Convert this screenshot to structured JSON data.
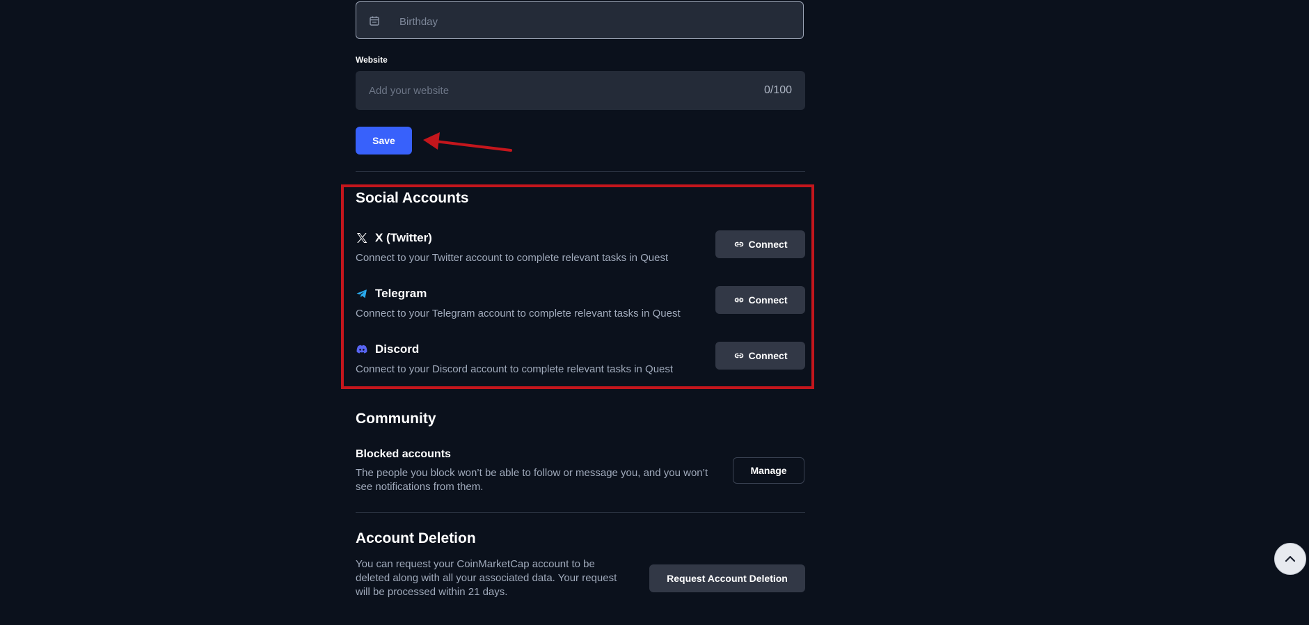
{
  "profile": {
    "birthday_placeholder": "Birthday",
    "website_label": "Website",
    "website_placeholder": "Add your website",
    "website_value": "",
    "website_counter": "0/100",
    "save_label": "Save"
  },
  "social": {
    "title": "Social Accounts",
    "accounts": [
      {
        "name": "X (Twitter)",
        "icon": "x-twitter-icon",
        "description": "Connect to your Twitter account to complete relevant tasks in Quest",
        "button_label": "Connect"
      },
      {
        "name": "Telegram",
        "icon": "telegram-icon",
        "description": "Connect to your Telegram account to complete relevant tasks in Quest",
        "button_label": "Connect"
      },
      {
        "name": "Discord",
        "icon": "discord-icon",
        "description": "Connect to your Discord account to complete relevant tasks in Quest",
        "button_label": "Connect"
      }
    ]
  },
  "community": {
    "title": "Community",
    "blocked_title": "Blocked accounts",
    "blocked_desc_line1": "The people you block won’t be able to follow or message you, and you won’t",
    "blocked_desc_line2": "see notifications from them.",
    "manage_label": "Manage"
  },
  "deletion": {
    "title": "Account Deletion",
    "desc_line1": "You can request your CoinMarketCap account to be",
    "desc_line2": "deleted along with all your associated data. Your request",
    "desc_line3": "will be processed within 21 days.",
    "button_label": "Request Account Deletion"
  },
  "colors": {
    "background": "#0b111c",
    "accent": "#3861fb",
    "annotation": "#c4161c",
    "telegram": "#2aabee",
    "discord": "#5865f2"
  }
}
